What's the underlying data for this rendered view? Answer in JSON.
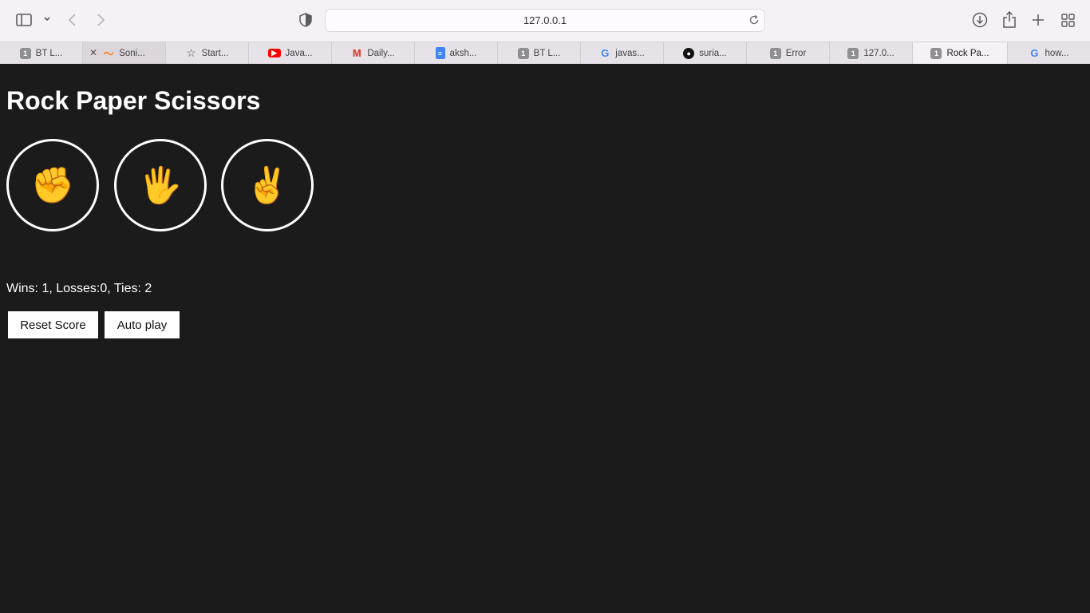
{
  "browser": {
    "url": "127.0.0.1",
    "tabs": [
      {
        "title": "BT L...",
        "icon": "numbered-favicon",
        "badge": "1"
      },
      {
        "title": "Soni...",
        "icon": "swoosh-favicon",
        "badge": ""
      },
      {
        "title": "Start...",
        "icon": "star-icon",
        "badge": ""
      },
      {
        "title": "Java...",
        "icon": "youtube-favicon",
        "badge": ""
      },
      {
        "title": "Daily...",
        "icon": "gmail-favicon",
        "badge": "M"
      },
      {
        "title": "aksh...",
        "icon": "docs-favicon",
        "badge": ""
      },
      {
        "title": "BT L...",
        "icon": "numbered-favicon",
        "badge": "1"
      },
      {
        "title": "javas...",
        "icon": "google-favicon",
        "badge": "G"
      },
      {
        "title": "suria...",
        "icon": "github-favicon",
        "badge": ""
      },
      {
        "title": "Error",
        "icon": "numbered-favicon",
        "badge": "1"
      },
      {
        "title": "127.0...",
        "icon": "numbered-favicon",
        "badge": "1"
      },
      {
        "title": "Rock Pa...",
        "icon": "numbered-favicon",
        "badge": "1"
      },
      {
        "title": "how...",
        "icon": "google-favicon",
        "badge": "G"
      }
    ]
  },
  "game": {
    "title": "Rock Paper Scissors",
    "moves": [
      {
        "name": "rock",
        "emoji": "✊"
      },
      {
        "name": "paper",
        "emoji": "🖐️"
      },
      {
        "name": "scissors",
        "emoji": "✌️"
      }
    ],
    "score_text": "Wins: 1, Losses:0, Ties: 2",
    "reset_label": "Reset Score",
    "autoplay_label": "Auto play"
  }
}
